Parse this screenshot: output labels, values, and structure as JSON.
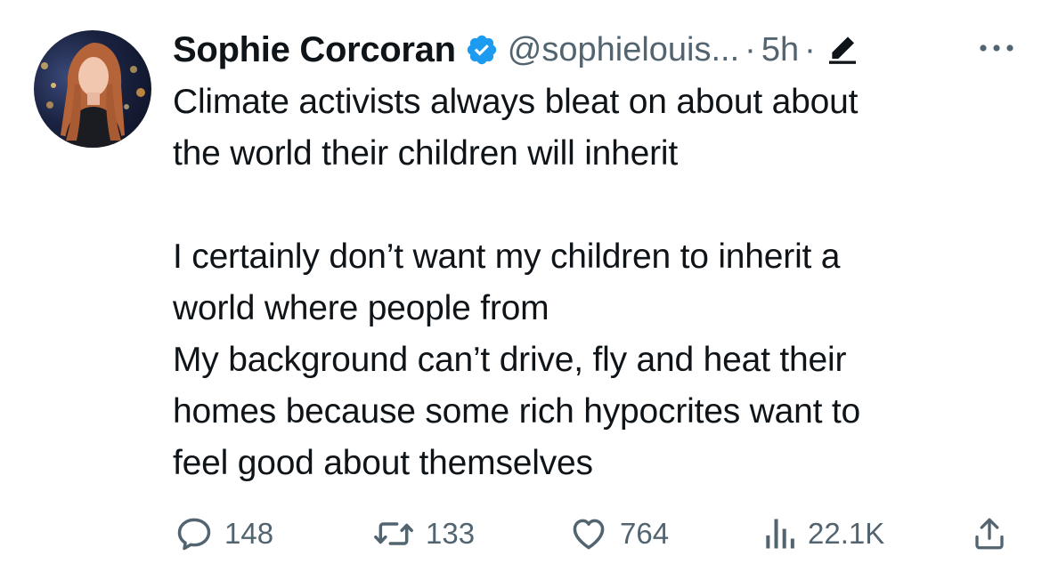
{
  "author": {
    "name": "Sophie Corcoran",
    "handle": "@sophielouis...",
    "time": "5h",
    "separator": "·"
  },
  "tweet": {
    "paragraphs": [
      [
        "Climate activists always bleat on about about",
        "the world their children will inherit"
      ],
      [
        "I certainly don’t want my children to inherit a",
        "world where people from",
        "My background can’t drive, fly and heat their",
        "homes because some rich hypocrites want to",
        "feel good about themselves"
      ]
    ]
  },
  "actions": {
    "replies": "148",
    "reposts": "133",
    "likes": "764",
    "views": "22.1K"
  },
  "icons": {
    "verified": "verified-badge-icon",
    "edit": "edited-pencil-icon",
    "more": "more-options-icon",
    "reply": "reply-icon",
    "repost": "repost-icon",
    "like": "like-heart-icon",
    "views": "views-bar-chart-icon",
    "share": "share-icon"
  },
  "colors": {
    "text": "#0f1419",
    "secondary": "#536471",
    "verified": "#1d9bf0"
  }
}
